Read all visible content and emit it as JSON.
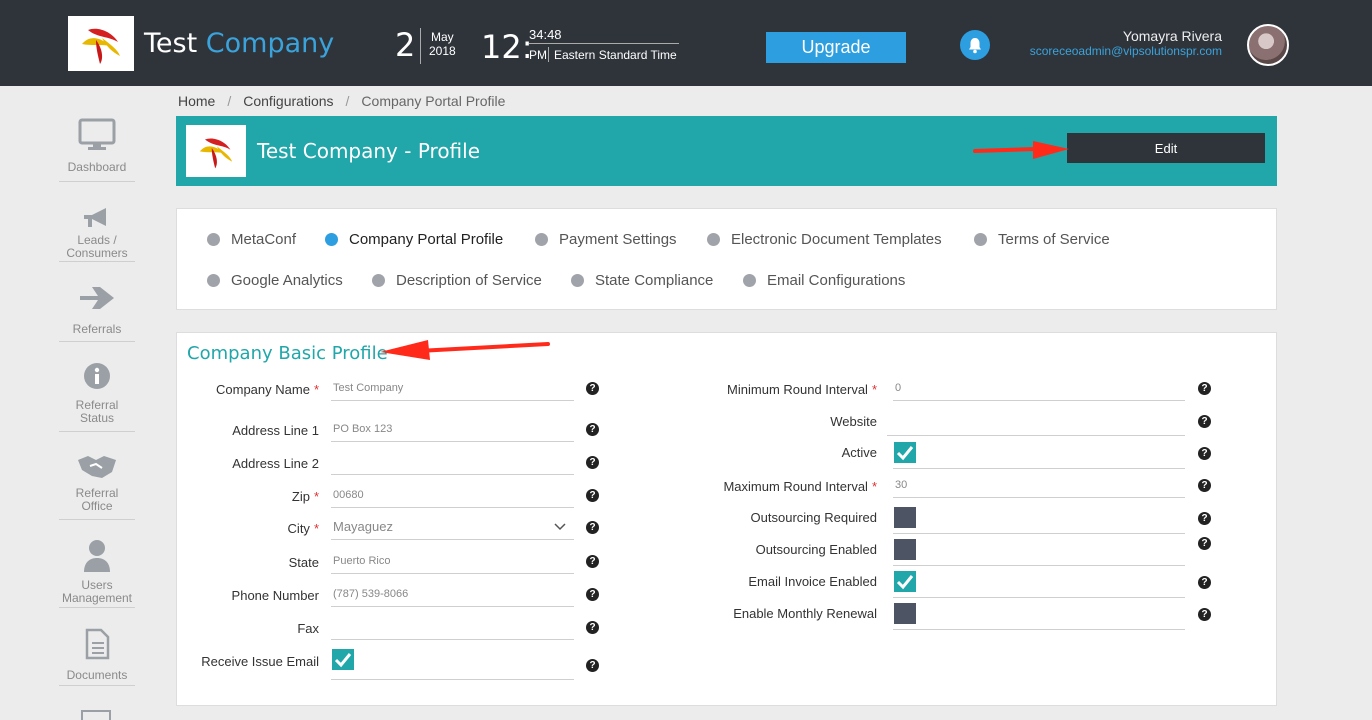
{
  "header": {
    "brand_first": "Test",
    "brand_second": "Company",
    "day": "2",
    "month": "May",
    "year": "2018",
    "hour": "12:",
    "minsec": "34:48",
    "ampm": "PM",
    "timezone": "Eastern Standard Time",
    "upgrade_label": "Upgrade",
    "user_name": "Yomayra Rivera",
    "user_email": "scoreceoadmin@vipsolutionspr.com"
  },
  "sidebar": {
    "items": [
      {
        "label": "Dashboard",
        "icon": "monitor-icon"
      },
      {
        "label": "Leads / Consumers",
        "icon": "megaphone-icon"
      },
      {
        "label": "Referrals",
        "icon": "arrow-right-icon"
      },
      {
        "label": "Referral Status",
        "icon": "info-icon"
      },
      {
        "label": "Referral Office",
        "icon": "handshake-icon"
      },
      {
        "label": "Users Management",
        "icon": "user-icon"
      },
      {
        "label": "Documents",
        "icon": "document-icon"
      }
    ]
  },
  "breadcrumb": [
    "Home",
    "Configurations",
    "Company Portal Profile"
  ],
  "banner": {
    "title": "Test Company - Profile",
    "edit_label": "Edit"
  },
  "tabs": [
    {
      "label": "MetaConf",
      "active": false
    },
    {
      "label": "Company Portal Profile",
      "active": true
    },
    {
      "label": "Payment Settings",
      "active": false
    },
    {
      "label": "Electronic Document Templates",
      "active": false
    },
    {
      "label": "Terms of Service",
      "active": false
    },
    {
      "label": "Google Analytics",
      "active": false
    },
    {
      "label": "Description of Service",
      "active": false
    },
    {
      "label": "State Compliance",
      "active": false
    },
    {
      "label": "Email Configurations",
      "active": false
    }
  ],
  "form": {
    "section_title": "Company Basic Profile",
    "left": [
      {
        "label": "Company Name",
        "required": "*",
        "value": "Test Company"
      },
      {
        "label": "Address Line 1",
        "required": "",
        "value": "PO Box 123"
      },
      {
        "label": "Address Line 2",
        "required": "",
        "value": ""
      },
      {
        "label": "Zip",
        "required": "*",
        "value": "00680"
      },
      {
        "label": "City",
        "required": "*",
        "value": "Mayaguez"
      },
      {
        "label": "State",
        "required": "",
        "value": "Puerto Rico"
      },
      {
        "label": "Phone Number",
        "required": "",
        "value": "(787) 539-8066"
      },
      {
        "label": "Fax",
        "required": "",
        "value": ""
      },
      {
        "label": "Receive Issue Email",
        "required": "",
        "checked": true
      }
    ],
    "right": [
      {
        "label": "Minimum Round Interval",
        "required": "*",
        "value": "0"
      },
      {
        "label": "Website",
        "required": "",
        "value": ""
      },
      {
        "label": "Active",
        "required": "",
        "checked": true
      },
      {
        "label": "Maximum Round Interval",
        "required": "*",
        "value": "30"
      },
      {
        "label": "Outsourcing Required",
        "required": "",
        "checked": false
      },
      {
        "label": "Outsourcing Enabled",
        "required": "",
        "checked": false
      },
      {
        "label": "Email Invoice Enabled",
        "required": "",
        "checked": true
      },
      {
        "label": "Enable Monthly Renewal",
        "required": "",
        "checked": false
      }
    ],
    "help_glyph": "?"
  },
  "colors": {
    "topbar": "#2f343b",
    "accent_blue": "#2d9ee0",
    "teal": "#21a6a9",
    "annotation_arrow": "#ff2a1a"
  }
}
